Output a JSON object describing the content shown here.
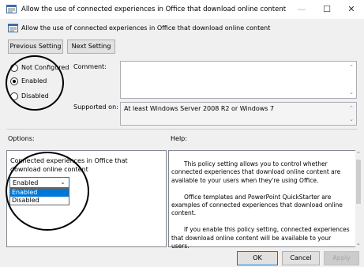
{
  "window": {
    "title": "Allow the use of connected experiences in Office that download online content",
    "minimize_glyph": "—",
    "maximize_glyph": "☐",
    "close_glyph": "✕"
  },
  "header": {
    "policy_title": "Allow the use of connected experiences in Office that download online content"
  },
  "nav": {
    "previous_label": "Previous Setting",
    "next_label": "Next Setting"
  },
  "state": {
    "options": [
      {
        "label": "Not Configured",
        "selected": false
      },
      {
        "label": "Enabled",
        "selected": true
      },
      {
        "label": "Disabled",
        "selected": false
      }
    ]
  },
  "comment": {
    "label": "Comment:",
    "value": ""
  },
  "supported": {
    "label": "Supported on:",
    "value": "At least Windows Server 2008 R2 or Windows 7"
  },
  "options_pane": {
    "label": "Options:",
    "setting_text": "Connected experiences in Office that download online content",
    "select_value": "Enabled",
    "dropdown_items": [
      "Enabled",
      "Disabled"
    ],
    "highlighted_item": "Enabled"
  },
  "help_pane": {
    "label": "Help:",
    "paragraphs": [
      "This policy setting allows you to control whether connected experiences that download online content are available to your users when they're using Office.",
      "Office templates and PowerPoint QuickStarter are examples of connected experiences that download online content.",
      "If you enable this policy setting, connected experiences that download online content will be available to your users."
    ]
  },
  "footer": {
    "ok_label": "OK",
    "cancel_label": "Cancel",
    "apply_label": "Apply"
  },
  "colors": {
    "accent": "#0078d7",
    "window_bg": "#f0f0f0",
    "disabled_text": "#a6a6a6"
  },
  "icons": {
    "app": "policy-window-icon",
    "policy": "policy-setting-icon"
  }
}
